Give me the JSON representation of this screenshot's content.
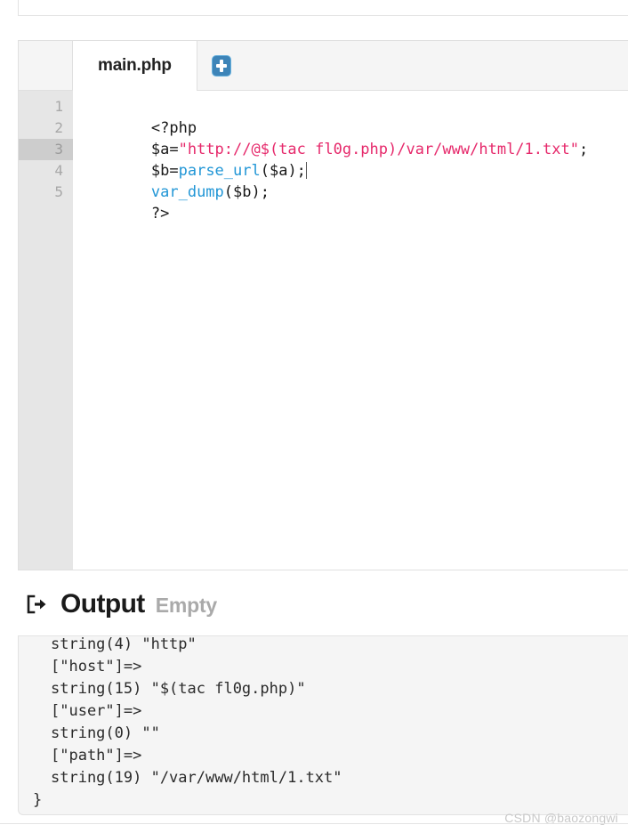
{
  "editor": {
    "tabs": [
      {
        "label": "main.php",
        "active": true
      }
    ],
    "add_tab_icon": "plus-icon",
    "add_tab_title": "New file",
    "language": "php",
    "active_line": 3,
    "gutter_numbers": [
      "1",
      "2",
      "3",
      "4",
      "5"
    ],
    "code_lines": [
      {
        "number": "1",
        "tokens": [
          {
            "text": "<?php",
            "kind": "plain"
          }
        ]
      },
      {
        "number": "2",
        "tokens": [
          {
            "text": "$a=",
            "kind": "plain"
          },
          {
            "text": "\"http://@$(tac fl0g.php)/var/www/html/1.txt\"",
            "kind": "string"
          },
          {
            "text": ";",
            "kind": "plain"
          }
        ]
      },
      {
        "number": "3",
        "tokens": [
          {
            "text": "$b=",
            "kind": "plain"
          },
          {
            "text": "parse_url",
            "kind": "func"
          },
          {
            "text": "($a);",
            "kind": "plain"
          }
        ]
      },
      {
        "number": "4",
        "tokens": [
          {
            "text": "var_dump",
            "kind": "func"
          },
          {
            "text": "($b);",
            "kind": "plain"
          }
        ]
      },
      {
        "number": "5",
        "tokens": [
          {
            "text": "?>",
            "kind": "plain"
          }
        ]
      }
    ],
    "plain_source": "<?php\n$a=\"http://@$(tac fl0g.php)/var/www/html/1.txt\";\n$b=parse_url($a);\nvar_dump($b);\n?>"
  },
  "output": {
    "icon": "sign-out-icon",
    "title": "Output",
    "status": "Empty",
    "lines": [
      {
        "text": "string(4) \"http\"",
        "indent": true
      },
      {
        "text": "[\"host\"]=>",
        "indent": true
      },
      {
        "text": "string(15) \"$(tac fl0g.php)\"",
        "indent": true
      },
      {
        "text": "[\"user\"]=>",
        "indent": true
      },
      {
        "text": "string(0) \"\"",
        "indent": true
      },
      {
        "text": "[\"path\"]=>",
        "indent": true
      },
      {
        "text": "string(19) \"/var/www/html/1.txt\"",
        "indent": true
      },
      {
        "text": "}",
        "indent": false
      }
    ]
  },
  "watermark": {
    "text": "CSDN @baozongwi"
  },
  "colors": {
    "string": "#e6296b",
    "function": "#2196d6",
    "plain": "#1a1a1a",
    "gutter_bg": "#e6e6e6",
    "gutter_active_bg": "#cdcdcd",
    "tabbar_bg": "#f5f5f5",
    "output_bg": "#f5f5f5",
    "accent": "#3d84b8",
    "status_gray": "#aaaaaa",
    "watermark_gray": "#c9c9c9"
  }
}
